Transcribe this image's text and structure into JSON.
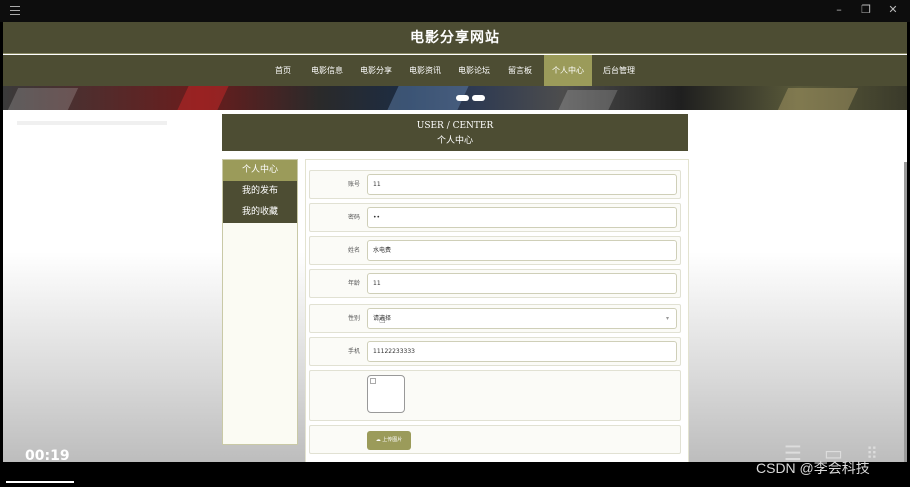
{
  "site": {
    "title": "电影分享网站"
  },
  "nav": {
    "items": [
      {
        "label": "首页"
      },
      {
        "label": "电影信息"
      },
      {
        "label": "电影分享"
      },
      {
        "label": "电影资讯"
      },
      {
        "label": "电影论坛"
      },
      {
        "label": "留言板"
      },
      {
        "label": "个人中心",
        "active": true
      },
      {
        "label": "后台管理"
      }
    ]
  },
  "section": {
    "title_en": "USER / CENTER",
    "title_cn": "个人中心"
  },
  "sidebar": {
    "items": [
      {
        "label": "个人中心",
        "active": true
      },
      {
        "label": "我的发布"
      },
      {
        "label": "我的收藏"
      }
    ]
  },
  "form": {
    "fields": [
      {
        "label": "账号",
        "value": "11"
      },
      {
        "label": "密码",
        "value": "••"
      },
      {
        "label": "姓名",
        "value": "水电费"
      },
      {
        "label": "年龄",
        "value": "11"
      },
      {
        "label": "性别",
        "value": "请选择"
      },
      {
        "label": "手机",
        "value": "11122233333"
      }
    ],
    "upload_label": "上传图片"
  },
  "video": {
    "time": "00:19",
    "progress": 0.08
  },
  "watermark": "CSDN @李会科技",
  "colors": {
    "header": "#4d4d33",
    "accent": "#9b9b5a"
  }
}
